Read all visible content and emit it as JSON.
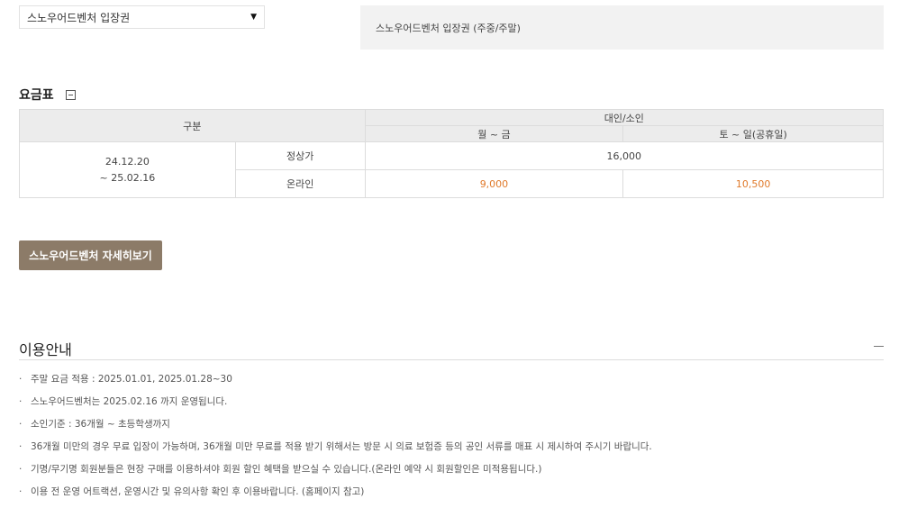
{
  "ticket_select": {
    "value": "스노우어드벤처 입장권"
  },
  "selected_ticket": {
    "text": "스노우어드벤처 입장권 (주중/주말)"
  },
  "price_table": {
    "title": "요금표",
    "headers": {
      "category": "구분",
      "group": "대인/소인",
      "weekday": "월 ~ 금",
      "weekend": "토 ~ 일(공휴일)"
    },
    "period_line1": "24.12.20",
    "period_line2": "~ 25.02.16",
    "rows": [
      {
        "label": "정상가",
        "merged_value": "16,000"
      },
      {
        "label": "온라인",
        "weekday": "9,000",
        "weekend": "10,500"
      }
    ]
  },
  "detail_button": {
    "label": "스노우어드벤처 자세히보기"
  },
  "info": {
    "title": "이용안내",
    "bullet": "·",
    "notes": [
      "주말 요금 적용 : 2025.01.01, 2025.01.28~30",
      "스노우어드벤처는 2025.02.16 까지 운영됩니다.",
      "소인기준 : 36개월 ~ 초등학생까지",
      "36개월 미만의 경우 무료 입장이 가능하며, 36개월 미만 무료를 적용 받기 위해서는 방문 시 의료 보험증 등의 공인 서류를 매표 시 제시하여 주시기 바랍니다.",
      "기명/무기명 회원분들은 현장 구매를 이용하셔야 회원 할인 혜택을 받으실 수 있습니다.(온라인 예약 시 회원할인은 미적용됩니다.)",
      "이용 전 운영 어트랙션, 운영시간 및 유의사항 확인 후 이용바랍니다. (홈페이지 참고)"
    ]
  },
  "colors": {
    "accent_price": "#e07a2b",
    "button_bg": "#8c7b68",
    "header_bg": "#ececec"
  }
}
